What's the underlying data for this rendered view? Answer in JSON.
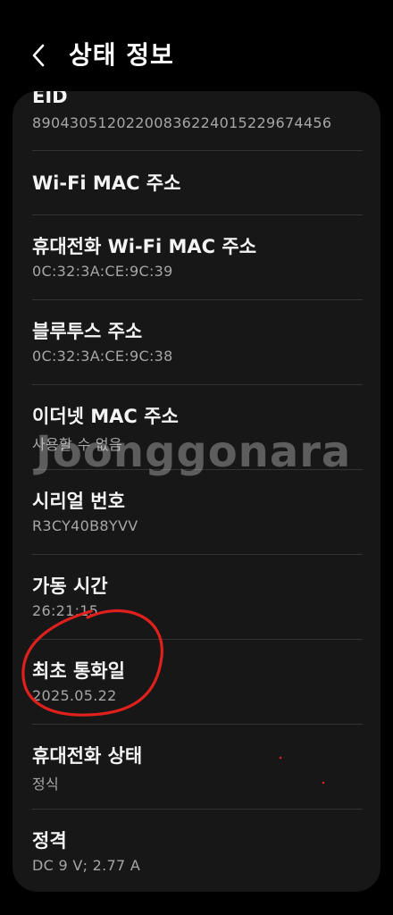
{
  "header": {
    "title": "상태 정보",
    "back_icon": "chevron-left-icon"
  },
  "items": [
    {
      "title": "EID",
      "value": "89043051202200836224015229674456"
    },
    {
      "title": "Wi-Fi MAC 주소",
      "value": ""
    },
    {
      "title": "휴대전화 Wi-Fi MAC 주소",
      "value": "0C:32:3A:CE:9C:39"
    },
    {
      "title": "블루투스 주소",
      "value": "0C:32:3A:CE:9C:38"
    },
    {
      "title": "이더넷 MAC 주소",
      "value": "사용할 수 없음"
    },
    {
      "title": "시리얼 번호",
      "value": "R3CY40B8YVV"
    },
    {
      "title": "가동 시간",
      "value": "26:21:15"
    },
    {
      "title": "최초 통화일",
      "value": "2025.05.22"
    },
    {
      "title": "휴대전화 상태",
      "value": "정식"
    },
    {
      "title": "정격",
      "value": "DC 9 V; 2.77 A"
    }
  ],
  "watermark": "Joonggonara",
  "colors": {
    "background": "#000000",
    "card": "#171717",
    "title_text": "#f4f4f4",
    "value_text": "#a6a6a6",
    "annotation": "#e0201c"
  }
}
